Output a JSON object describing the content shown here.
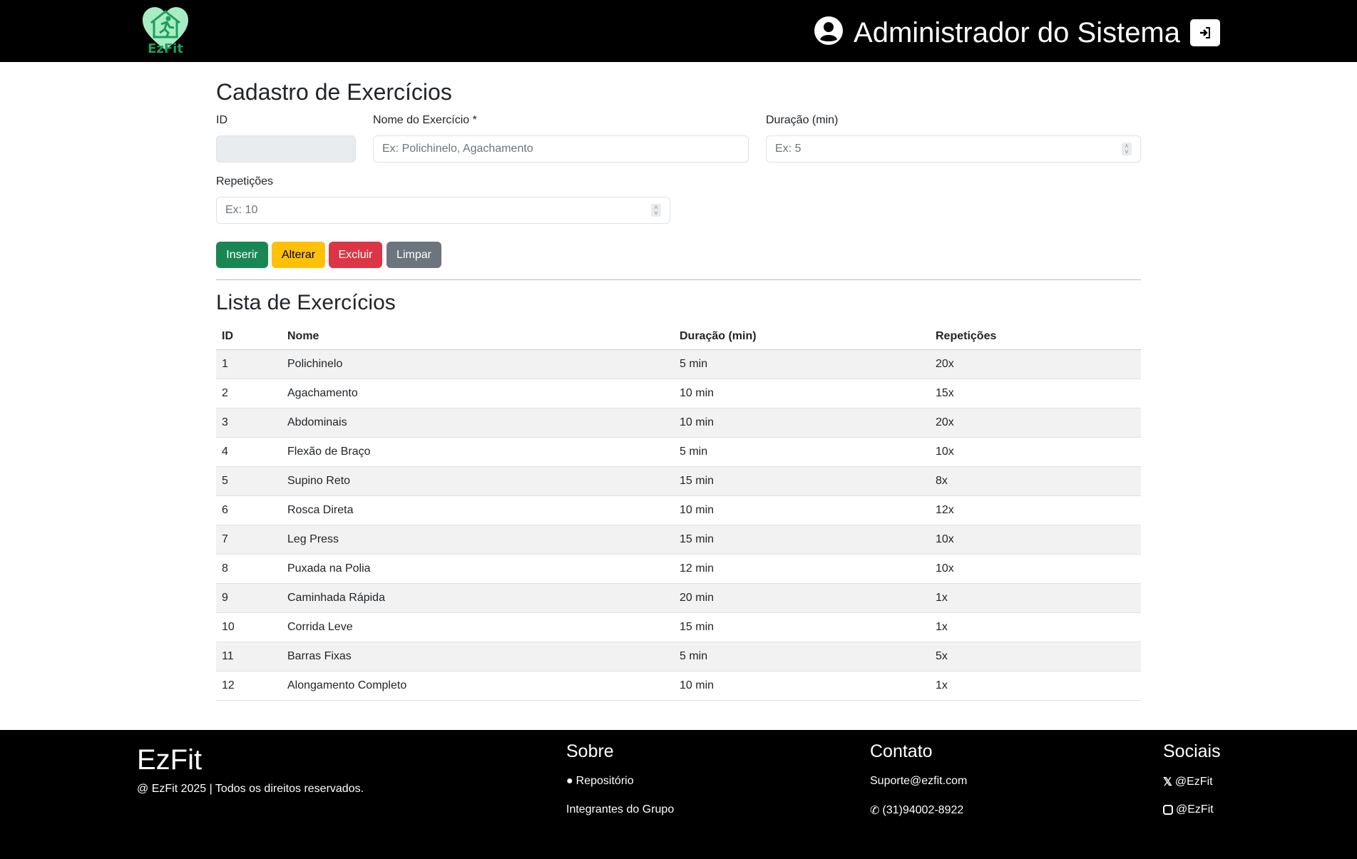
{
  "header": {
    "logo_text": "EzFit",
    "user_name": "Administrador do Sistema"
  },
  "form": {
    "title": "Cadastro de Exercícios",
    "id_label": "ID",
    "nome_label": "Nome do Exercício *",
    "nome_placeholder": "Ex: Polichinelo, Agachamento",
    "duracao_label": "Duração (min)",
    "duracao_placeholder": "Ex: 5",
    "repeticoes_label": "Repetições",
    "repeticoes_placeholder": "Ex: 10",
    "buttons": {
      "inserir": "Inserir",
      "alterar": "Alterar",
      "excluir": "Excluir",
      "limpar": "Limpar"
    }
  },
  "list": {
    "title": "Lista de Exercícios",
    "columns": [
      "ID",
      "Nome",
      "Duração (min)",
      "Repetições"
    ],
    "rows": [
      [
        "1",
        "Polichinelo",
        "5 min",
        "20x"
      ],
      [
        "2",
        "Agachamento",
        "10 min",
        "15x"
      ],
      [
        "3",
        "Abdominais",
        "10 min",
        "20x"
      ],
      [
        "4",
        "Flexão de Braço",
        "5 min",
        "10x"
      ],
      [
        "5",
        "Supino Reto",
        "15 min",
        "8x"
      ],
      [
        "6",
        "Rosca Direta",
        "10 min",
        "12x"
      ],
      [
        "7",
        "Leg Press",
        "15 min",
        "10x"
      ],
      [
        "8",
        "Puxada na Polia",
        "12 min",
        "10x"
      ],
      [
        "9",
        "Caminhada Rápida",
        "20 min",
        "1x"
      ],
      [
        "10",
        "Corrida Leve",
        "15 min",
        "1x"
      ],
      [
        "11",
        "Barras Fixas",
        "5 min",
        "5x"
      ],
      [
        "12",
        "Alongamento Completo",
        "10 min",
        "1x"
      ]
    ]
  },
  "footer": {
    "brand": "EzFit",
    "copyright": "@ EzFit 2025 | Todos os direitos reservados.",
    "sobre": {
      "title": "Sobre",
      "repo": "Repositório",
      "grupo": "Integrantes do Grupo"
    },
    "contato": {
      "title": "Contato",
      "email": "Suporte@ezfit.com",
      "phone": "(31)94002-8922"
    },
    "sociais": {
      "title": "Sociais",
      "x": "@EzFit",
      "instagram": "@EzFit"
    }
  },
  "colors": {
    "success": "#198754",
    "warning": "#ffc107",
    "danger": "#dc3545",
    "secondary": "#6c757d",
    "logo_green": "#1e9e5e",
    "logo_light": "#a8ecc4"
  }
}
